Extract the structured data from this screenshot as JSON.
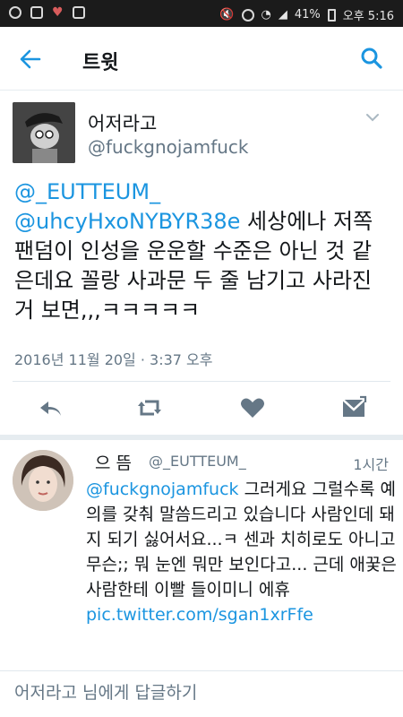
{
  "status_bar": {
    "battery": "41%",
    "time": "오후 5:16",
    "icons": [
      "notification-icon",
      "gallery-icon",
      "heart-icon",
      "clipboard-icon",
      "mute-icon",
      "alarm-icon",
      "wifi-icon",
      "signal-icon",
      "battery-icon"
    ]
  },
  "header": {
    "title": "트윗",
    "back_icon": "arrow-left-icon",
    "search_icon": "search-icon"
  },
  "tweet": {
    "display_name": "어저라고",
    "handle": "@fuckgnojamfuck",
    "mention1": "@_EUTTEUM_",
    "mention2": "@uhcyHxoNYBYR38e",
    "body": " 세상에나 저쪽 팬덤이 인성을 운운할 수준은 아닌 것 같은데요 꼴랑 사과문 두 줄 남기고 사라진 거 보면,,,ㅋㅋㅋㅋㅋ",
    "timestamp": "2016년 11월 20일 · 3:37 오후",
    "actions": [
      "reply-icon",
      "retweet-icon",
      "like-icon",
      "message-icon"
    ]
  },
  "reply": {
    "name": "으 뜸",
    "handle": "@_EUTTEUM_",
    "time": "1시간",
    "mention": "@fuckgnojamfuck",
    "body": " 그러게요 그럴수록 예의를 갖춰 말씀드리고 있습니다 사람인데 돼지 되기 싫어서요...ㅋ 센과 치히로도 아니고 무슨;; 뭐 눈엔 뭐만 보인다고... 근데 애꿎은 사람한테 이빨 들이미니 에휴",
    "link": "pic.twitter.com/sgan1xrFfe"
  },
  "compose": {
    "placeholder": "어저라고 님에게 답글하기"
  },
  "colors": {
    "accent": "#1b95e0",
    "text": "#14171a",
    "secondary": "#657786"
  }
}
